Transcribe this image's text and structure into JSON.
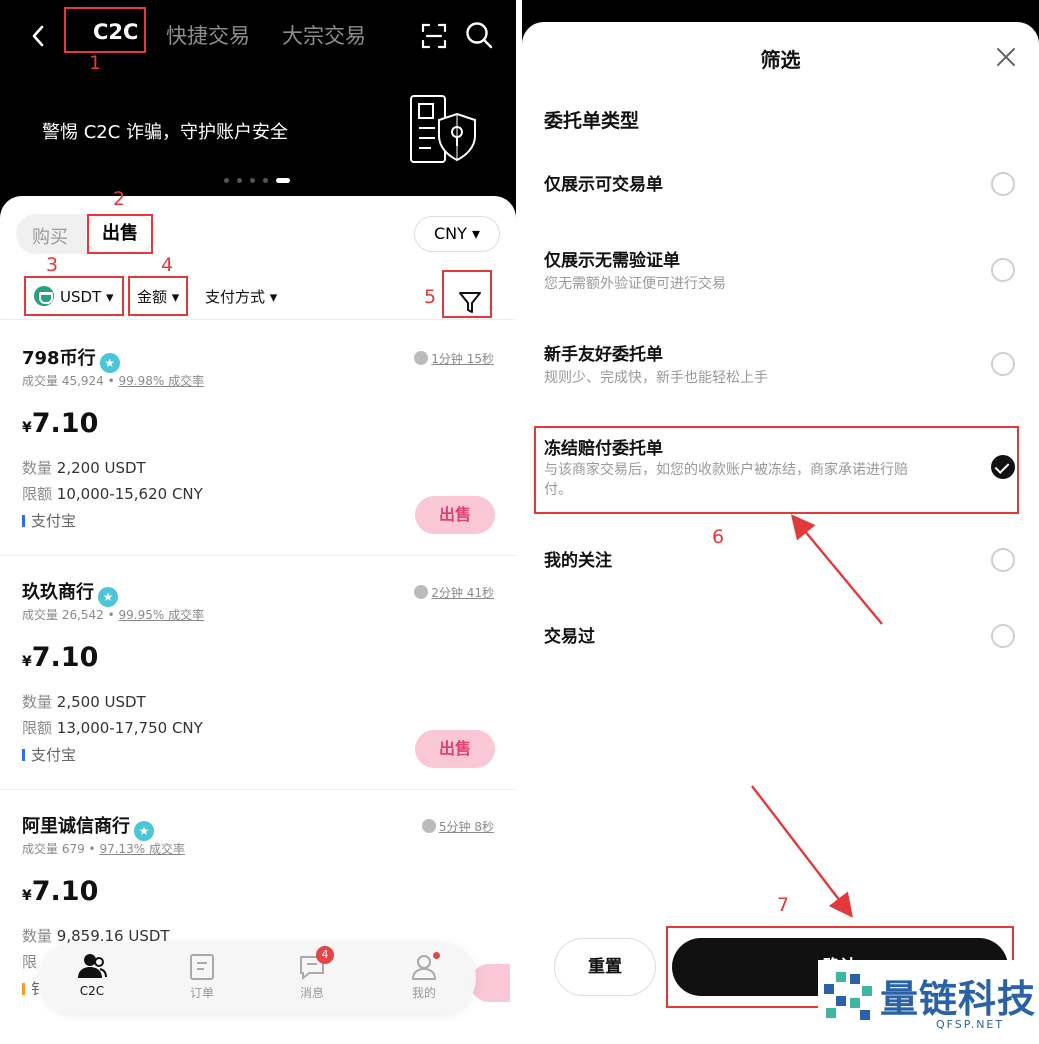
{
  "left": {
    "header": {
      "tabs": [
        "C2C",
        "快捷交易",
        "大宗交易"
      ]
    },
    "banner": {
      "text": "警惕 C2C 诈骗，守护账户安全"
    },
    "segment": {
      "buy": "购买",
      "sell": "出售"
    },
    "currency": "CNY ▾",
    "filters": {
      "coin": "USDT ▾",
      "amount": "金额 ▾",
      "payment": "支付方式 ▾"
    },
    "ads": [
      {
        "merchant": "798币行",
        "time": "1分钟 15秒",
        "volume_label": "成交量 45,924",
        "rate": "99.98% 成交率",
        "currency_sign": "¥",
        "price": "7.10",
        "qty_label": "数量",
        "qty": "2,200 USDT",
        "limit_label": "限额",
        "limit": "10,000-15,620 CNY",
        "payment": "支付宝",
        "action": "出售"
      },
      {
        "merchant": "玖玖商行",
        "time": "2分钟 41秒",
        "volume_label": "成交量 26,542",
        "rate": "99.95% 成交率",
        "currency_sign": "¥",
        "price": "7.10",
        "qty_label": "数量",
        "qty": "2,500 USDT",
        "limit_label": "限额",
        "limit": "13,000-17,750 CNY",
        "payment": "支付宝",
        "action": "出售"
      },
      {
        "merchant": "阿里诚信商行",
        "time": "5分钟 8秒",
        "volume_label": "成交量 679",
        "rate": "97.13% 成交率",
        "currency_sign": "¥",
        "price": "7.10",
        "qty_label": "数量",
        "qty": "9,859.16 USDT",
        "limit_label": "限",
        "limit": "",
        "payment": "钅",
        "action": ""
      }
    ],
    "nav": [
      {
        "label": "C2C",
        "active": true
      },
      {
        "label": "订单"
      },
      {
        "label": "消息",
        "badge": "4"
      },
      {
        "label": "我的",
        "dot": true
      }
    ],
    "annotations": [
      "1",
      "2",
      "3",
      "4",
      "5"
    ]
  },
  "right": {
    "title": "筛选",
    "section": "委托单类型",
    "options": [
      {
        "title": "仅展示可交易单",
        "desc": "",
        "checked": false
      },
      {
        "title": "仅展示无需验证单",
        "desc": "您无需额外验证便可进行交易",
        "checked": false
      },
      {
        "title": "新手友好委托单",
        "desc": "规则少、完成快，新手也能轻松上手",
        "checked": false
      },
      {
        "title": "冻结赔付委托单",
        "desc": "与该商家交易后，如您的收款账户被冻结，商家承诺进行赔付。",
        "checked": true
      },
      {
        "title": "我的关注",
        "desc": "",
        "checked": false
      },
      {
        "title": "交易过",
        "desc": "",
        "checked": false
      }
    ],
    "reset": "重置",
    "confirm": "确认",
    "annotations": [
      "6",
      "7"
    ],
    "watermark": {
      "name": "量链科技",
      "site": "QFSP.NET"
    }
  },
  "colors": {
    "annotation_red": "#e3393a",
    "sell_pink": "#f9c7d5",
    "sell_text": "#e0426d",
    "watermark_blue": "#2a62a8"
  }
}
